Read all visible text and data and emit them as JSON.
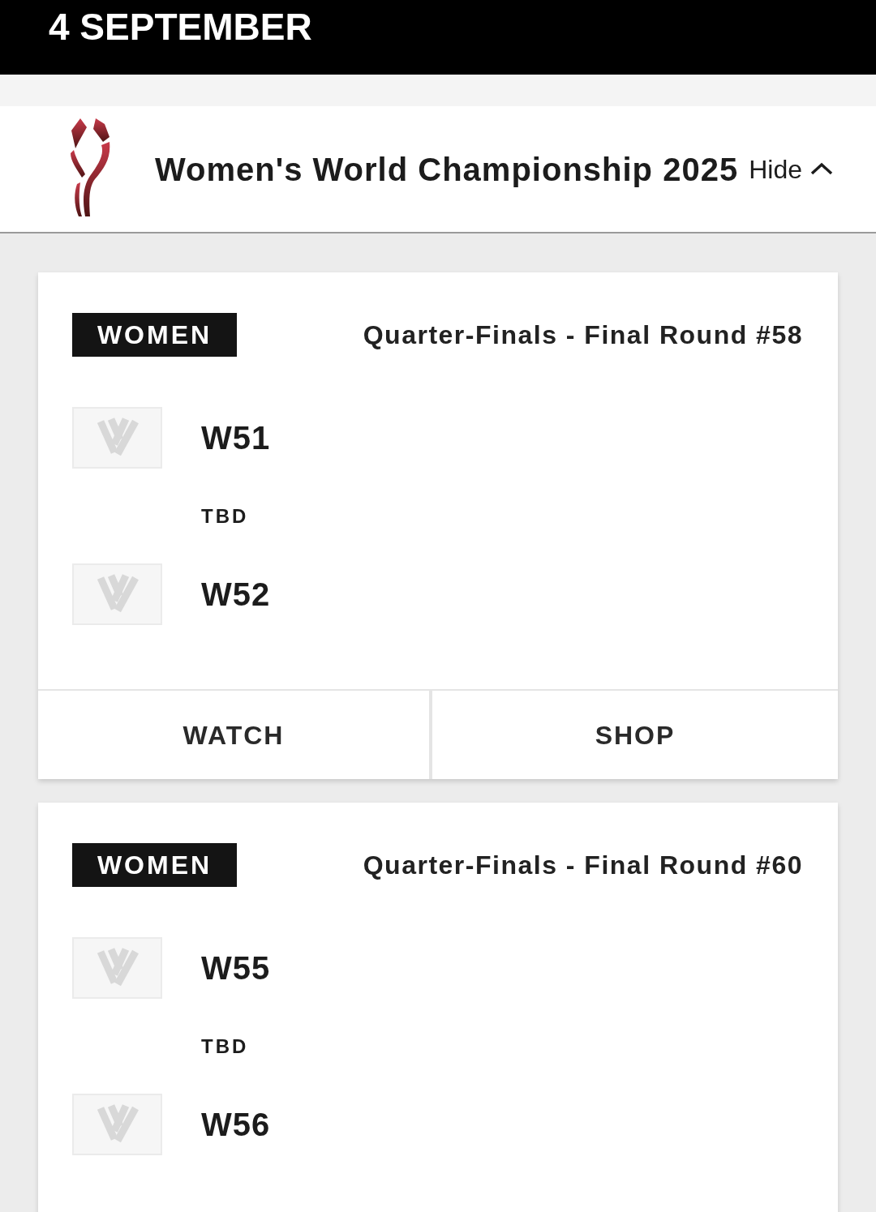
{
  "date_header": {
    "title": "4 SEPTEMBER"
  },
  "competition": {
    "title": "Women's World Championship 2025",
    "toggle_label": "Hide",
    "expanded": true
  },
  "matches": [
    {
      "category": "WOMEN",
      "round": "Quarter-Finals - Final Round #58",
      "teams": [
        {
          "name": "W51"
        },
        {
          "name": "W52"
        }
      ],
      "status": "TBD",
      "actions": [
        "WATCH",
        "SHOP"
      ]
    },
    {
      "category": "WOMEN",
      "round": "Quarter-Finals - Final Round #60",
      "teams": [
        {
          "name": "W55"
        },
        {
          "name": "W56"
        }
      ],
      "status": "TBD"
    }
  ]
}
